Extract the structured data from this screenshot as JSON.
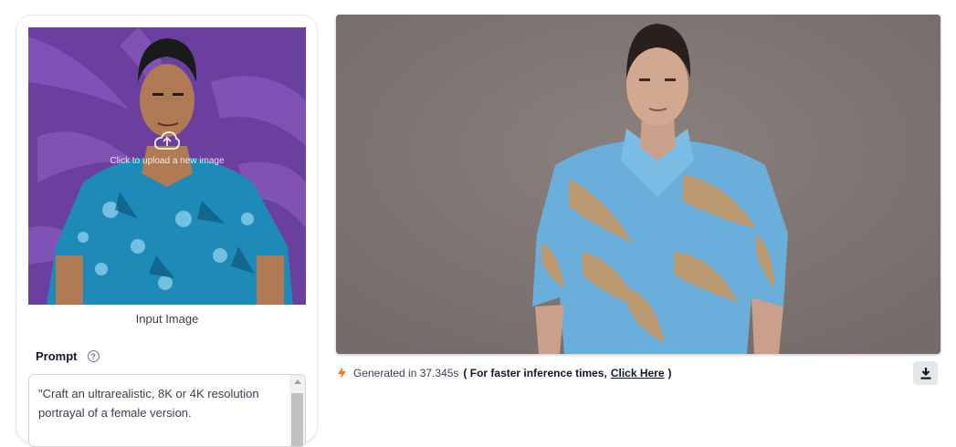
{
  "left_panel": {
    "upload_hint": "Click to upload a new image",
    "input_caption": "Input Image",
    "prompt_label": "Prompt",
    "prompt_text": "\"Craft an ultrarealistic, 8K or 4K resolution portrayal of a female version."
  },
  "status": {
    "generated_text": "Generated in 37.345s",
    "faster_prefix": "( For faster inference times,",
    "click_here": "Click Here",
    "suffix": ")"
  },
  "icons": {
    "help": "question-circle-icon",
    "upload": "cloud-upload-icon",
    "bolt": "lightning-bolt-icon",
    "download": "download-icon"
  },
  "colors": {
    "bolt": "#f97316",
    "purple_bg": "#6b3fa0",
    "output_bg": "#7d7472"
  }
}
